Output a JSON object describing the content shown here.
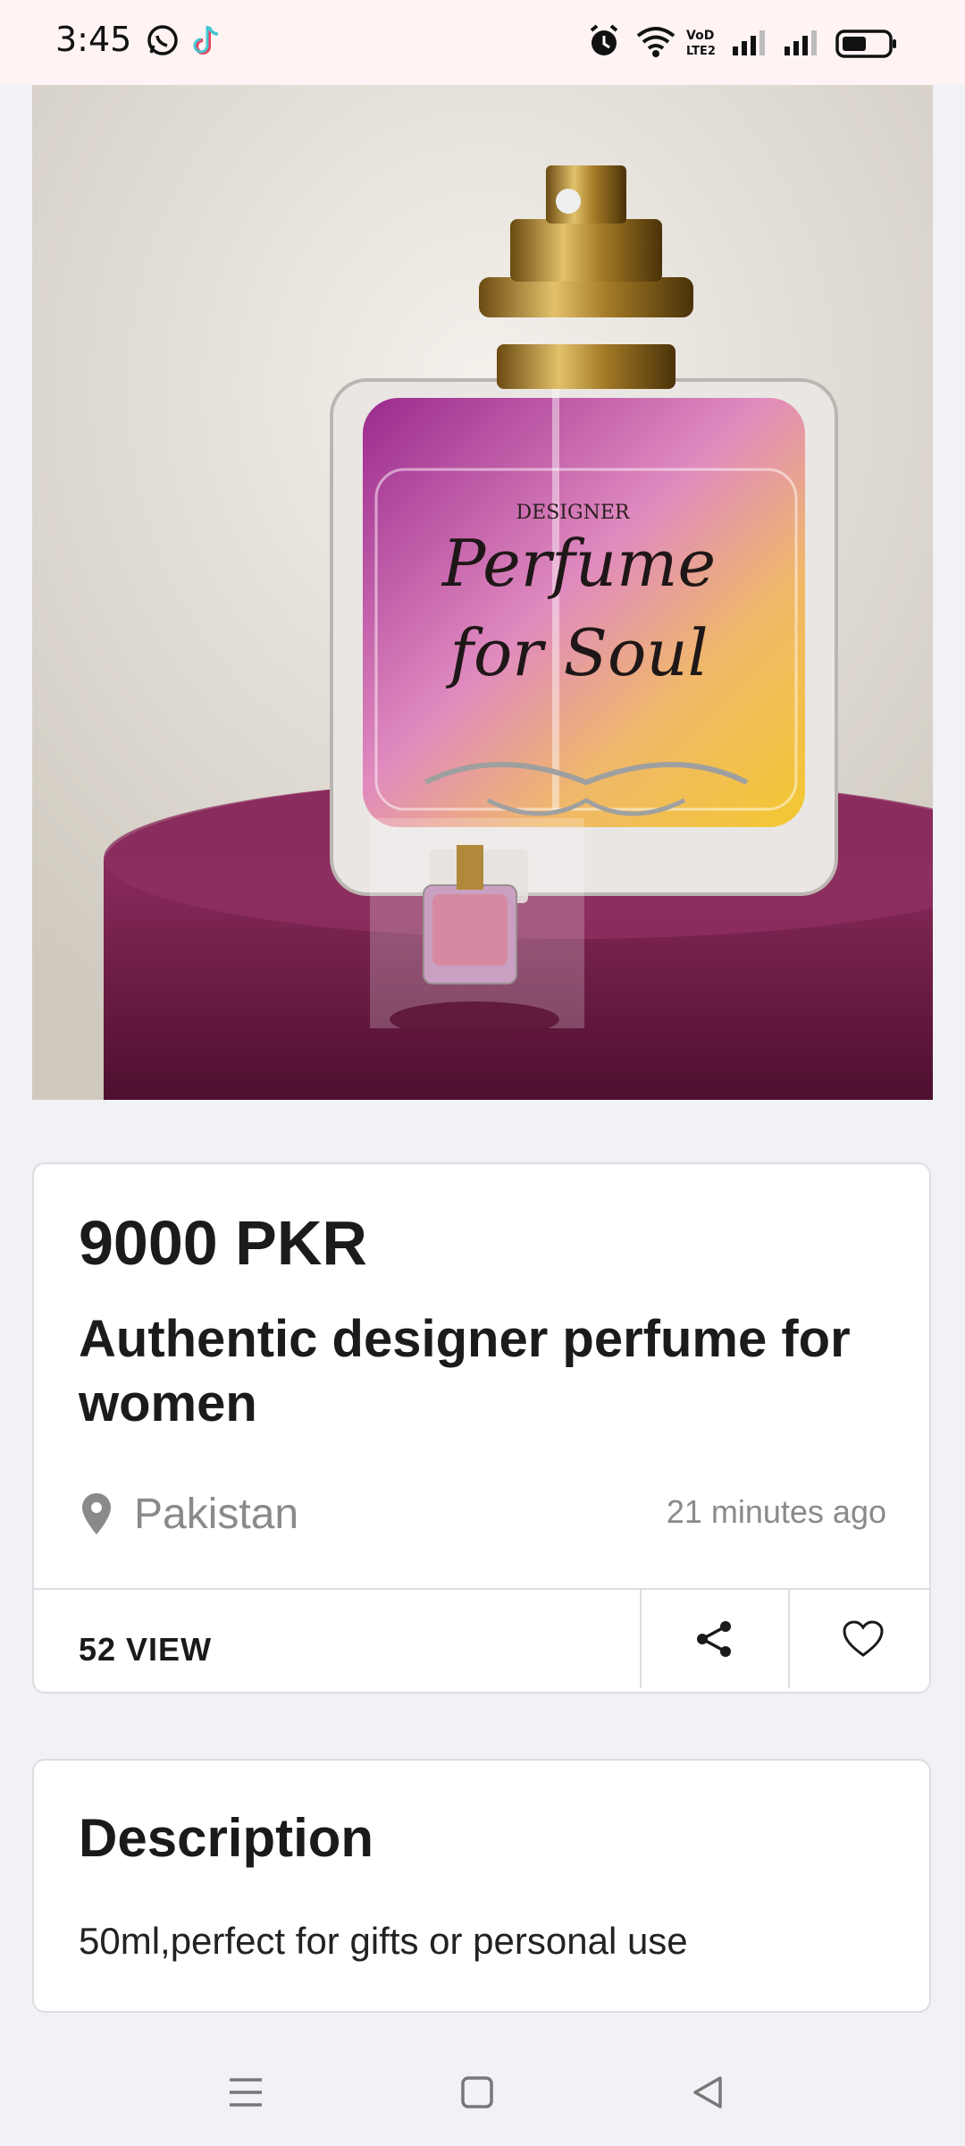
{
  "status_bar": {
    "time": "3:45",
    "left_icons": [
      "whatsapp-icon",
      "tiktok-icon"
    ],
    "right_icons": [
      "alarm-icon",
      "wifi-icon",
      "volte-icon",
      "signal-icon",
      "signal-icon",
      "battery-icon"
    ],
    "volte_label": "VoD LTE2"
  },
  "product_image": {
    "label_top": "DESIGNER",
    "label_line1": "Perfume",
    "label_line2": "for Soul"
  },
  "listing": {
    "price": "9000 PKR",
    "title": "Authentic designer perfume for women",
    "location": "Pakistan",
    "posted": "21 minutes ago",
    "views": "52 VIEW"
  },
  "description": {
    "heading": "Description",
    "text": "50ml,perfect for gifts or personal use"
  },
  "nav_bar": {
    "buttons": [
      "menu-icon",
      "home-icon",
      "back-icon"
    ]
  },
  "colors": {
    "status_bg": "#fff4f3",
    "page_bg": "#f1f2f6",
    "card_border": "#dcdde2",
    "muted_text": "#8a8a8a"
  }
}
